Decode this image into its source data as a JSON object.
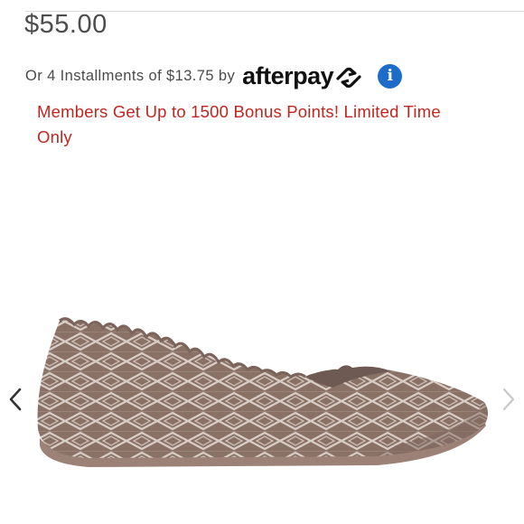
{
  "product": {
    "price": "$55.00",
    "installments_text": "Or 4 Installments of $13.75 by",
    "afterpay_brand": "afterpay",
    "info_icon_glyph": "i",
    "promo_text": "Members Get Up to 1500 Bonus Points! Limited Time Only",
    "image_alt": "Slip-on knit ballet flat shoe"
  },
  "icons": {
    "info": "info-icon",
    "prev": "chevron-left-icon",
    "next": "chevron-right-icon",
    "afterpay_mark": "afterpay-arrows-icon"
  },
  "colors": {
    "price": "#4d4d4d",
    "promo": "#c0261f",
    "info_button": "#1e6cc9",
    "shoe": "#8a7166",
    "prev_arrow": "#333333",
    "next_arrow": "#c8c8c8"
  }
}
